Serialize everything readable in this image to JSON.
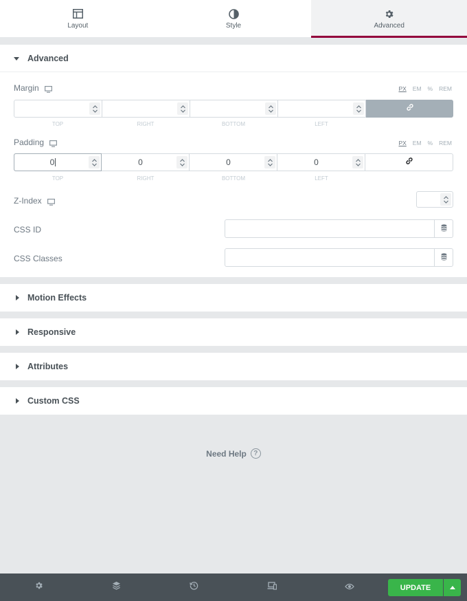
{
  "tabs": [
    {
      "label": "Layout",
      "icon": "layout-icon"
    },
    {
      "label": "Style",
      "icon": "contrast-icon"
    },
    {
      "label": "Advanced",
      "icon": "gear-icon"
    }
  ],
  "advanced": {
    "title": "Advanced",
    "margin": {
      "label": "Margin",
      "units": [
        "PX",
        "EM",
        "%",
        "REM"
      ],
      "selected_unit": "PX",
      "values": [
        "",
        "",
        "",
        ""
      ],
      "sides": [
        "TOP",
        "RIGHT",
        "BOTTOM",
        "LEFT"
      ]
    },
    "padding": {
      "label": "Padding",
      "units": [
        "PX",
        "EM",
        "%",
        "REM"
      ],
      "selected_unit": "PX",
      "values": [
        "0",
        "0",
        "0",
        "0"
      ],
      "sides": [
        "TOP",
        "RIGHT",
        "BOTTOM",
        "LEFT"
      ]
    },
    "zindex": {
      "label": "Z-Index",
      "value": ""
    },
    "css_id": {
      "label": "CSS ID",
      "value": ""
    },
    "css_classes": {
      "label": "CSS Classes",
      "value": ""
    }
  },
  "sections": [
    {
      "title": "Motion Effects"
    },
    {
      "title": "Responsive"
    },
    {
      "title": "Attributes"
    },
    {
      "title": "Custom CSS"
    }
  ],
  "help": {
    "label": "Need Help",
    "icon_text": "?"
  },
  "footer": {
    "update_label": "UPDATE"
  },
  "colors": {
    "accent": "#93003c",
    "update": "#39b54a",
    "footer": "#495157"
  }
}
